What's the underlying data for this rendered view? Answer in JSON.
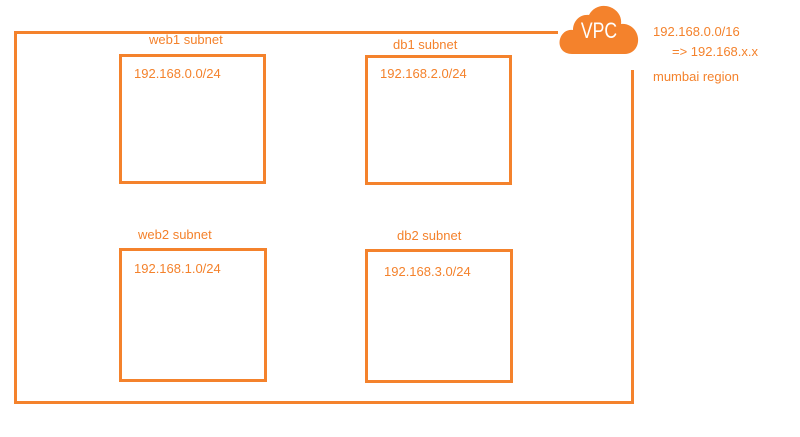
{
  "vpc": {
    "label": "VPC",
    "cidr": "192.168.0.0/16",
    "range": "=> 192.168.x.x",
    "region": "mumbai region"
  },
  "subnets": [
    {
      "title": "web1 subnet",
      "cidr": "192.168.0.0/24"
    },
    {
      "title": "db1 subnet",
      "cidr": "192.168.2.0/24"
    },
    {
      "title": "web2 subnet",
      "cidr": "192.168.1.0/24"
    },
    {
      "title": "db2 subnet",
      "cidr": "192.168.3.0/24"
    }
  ],
  "colors": {
    "accent": "#f4822c",
    "background": "#ffffff"
  },
  "icons": {
    "vpc": "cloud-icon"
  }
}
